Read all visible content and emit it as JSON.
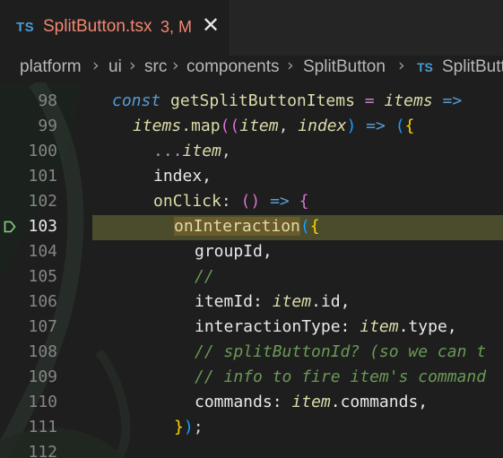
{
  "tab": {
    "lang_badge": "TS",
    "filename": "SplitButton.tsx",
    "status": "3, M",
    "close_glyph": "✕"
  },
  "breadcrumb": {
    "items": [
      "platform",
      "ui",
      "src",
      "components",
      "SplitButton",
      "SplitButt"
    ],
    "ts_badge": "TS",
    "separator": "›"
  },
  "editor": {
    "current_line": 103,
    "lines": [
      {
        "num": "98"
      },
      {
        "num": "99"
      },
      {
        "num": "100"
      },
      {
        "num": "101"
      },
      {
        "num": "102"
      },
      {
        "num": "103"
      },
      {
        "num": "104"
      },
      {
        "num": "105"
      },
      {
        "num": "106"
      },
      {
        "num": "107"
      },
      {
        "num": "108"
      },
      {
        "num": "109"
      },
      {
        "num": "110"
      },
      {
        "num": "111"
      },
      {
        "num": "112"
      }
    ],
    "tokens": {
      "l98_const": "const",
      "l98_name": "getSplitButtonItems",
      "l98_eq": "=",
      "l98_param": "items",
      "l98_arrow": "=>",
      "l99_items": "items",
      "l99_map": ".map",
      "l99_open": "((",
      "l99_item": "item",
      "l99_comma": ",",
      "l99_index": "index",
      "l99_close": ")",
      "l99_arrow": "=>",
      "l99_paren": "(",
      "l99_brace": "{",
      "l100_spread": "...",
      "l100_item": "item",
      "l100_comma": ",",
      "l101_text": "index,",
      "l102_key": "onClick",
      "l102_colon": ":",
      "l102_parens": "()",
      "l102_arrow": "=>",
      "l102_brace": "{",
      "l103_fn": "onInteraction",
      "l103_paren": "(",
      "l103_brace": "{",
      "l104_text": "groupId,",
      "l105_text": "//",
      "l106_key": "itemId:",
      "l106_item": "item",
      "l106_rest": ".id,",
      "l107_key": "interactionType:",
      "l107_item": "item",
      "l107_rest": ".type,",
      "l108_text": "// splitButtonId? (so we can t",
      "l109_text": "// info to fire item's command",
      "l110_key": "commands:",
      "l110_item": "item",
      "l110_rest": ".commands,",
      "l111_brace": "}",
      "l111_paren": ")",
      "l111_semi": ";"
    }
  },
  "colors": {
    "background": "#1e1e1e",
    "line_highlight": "#4a4c2c",
    "tab_error": "#f48771",
    "ts_badge": "#4b9cd3"
  }
}
